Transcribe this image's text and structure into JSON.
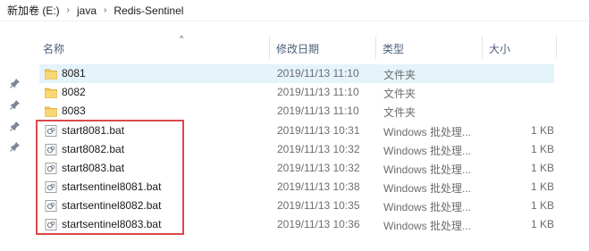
{
  "breadcrumb": [
    "新加卷 (E:)",
    "java",
    "Redis-Sentinel"
  ],
  "columns": {
    "name": "名称",
    "date": "修改日期",
    "type": "类型",
    "size": "大小"
  },
  "items": [
    {
      "name": "8081",
      "date": "2019/11/13 11:10",
      "type": "文件夹",
      "size": "",
      "icon": "folder-icon"
    },
    {
      "name": "8082",
      "date": "2019/11/13 11:10",
      "type": "文件夹",
      "size": "",
      "icon": "folder-icon"
    },
    {
      "name": "8083",
      "date": "2019/11/13 11:10",
      "type": "文件夹",
      "size": "",
      "icon": "folder-icon"
    },
    {
      "name": "start8081.bat",
      "date": "2019/11/13 10:31",
      "type": "Windows 批处理...",
      "size": "1 KB",
      "icon": "batch-file-icon"
    },
    {
      "name": "start8082.bat",
      "date": "2019/11/13 10:32",
      "type": "Windows 批处理...",
      "size": "1 KB",
      "icon": "batch-file-icon"
    },
    {
      "name": "start8083.bat",
      "date": "2019/11/13 10:32",
      "type": "Windows 批处理...",
      "size": "1 KB",
      "icon": "batch-file-icon"
    },
    {
      "name": "startsentinel8081.bat",
      "date": "2019/11/13 10:38",
      "type": "Windows 批处理...",
      "size": "1 KB",
      "icon": "batch-file-icon"
    },
    {
      "name": "startsentinel8082.bat",
      "date": "2019/11/13 10:35",
      "type": "Windows 批处理...",
      "size": "1 KB",
      "icon": "batch-file-icon"
    },
    {
      "name": "startsentinel8083.bat",
      "date": "2019/11/13 10:36",
      "type": "Windows 批处理...",
      "size": "1 KB",
      "icon": "batch-file-icon"
    }
  ],
  "colors": {
    "highlight_border": "#d94a4a",
    "folder_yellow": "#f3c44a",
    "header_text": "#4c607a"
  }
}
